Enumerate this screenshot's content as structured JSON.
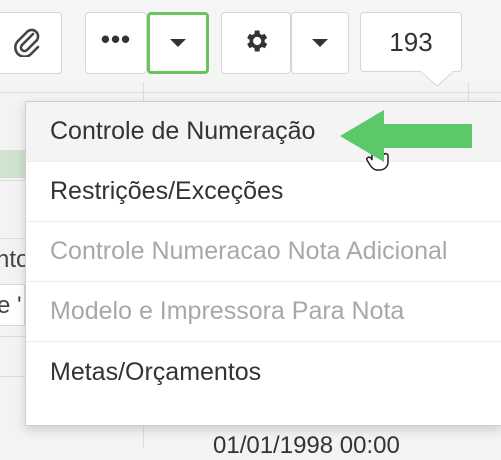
{
  "toolbar": {
    "attach_icon": "paperclip-icon",
    "more_icon": "more-dots-icon",
    "more_label": "•••",
    "dropdown_icon": "caret-down-icon",
    "settings_icon": "gear-icon",
    "count_value": "193"
  },
  "menu": {
    "items": [
      {
        "label": "Controle de Numeração",
        "enabled": true
      },
      {
        "label": "Restrições/Exceções",
        "enabled": true
      },
      {
        "label": "Controle Numeracao Nota Adicional",
        "enabled": false
      },
      {
        "label": "Modelo e Impressora Para Nota",
        "enabled": false
      },
      {
        "label": "Metas/Orçamentos",
        "enabled": true
      }
    ]
  },
  "background": {
    "left_fragments": [
      "nto",
      "e '"
    ],
    "date_text": "01/01/1998 00:00"
  },
  "annotation": {
    "arrow_color": "#5cc86a",
    "highlight_color": "#67c45f"
  }
}
